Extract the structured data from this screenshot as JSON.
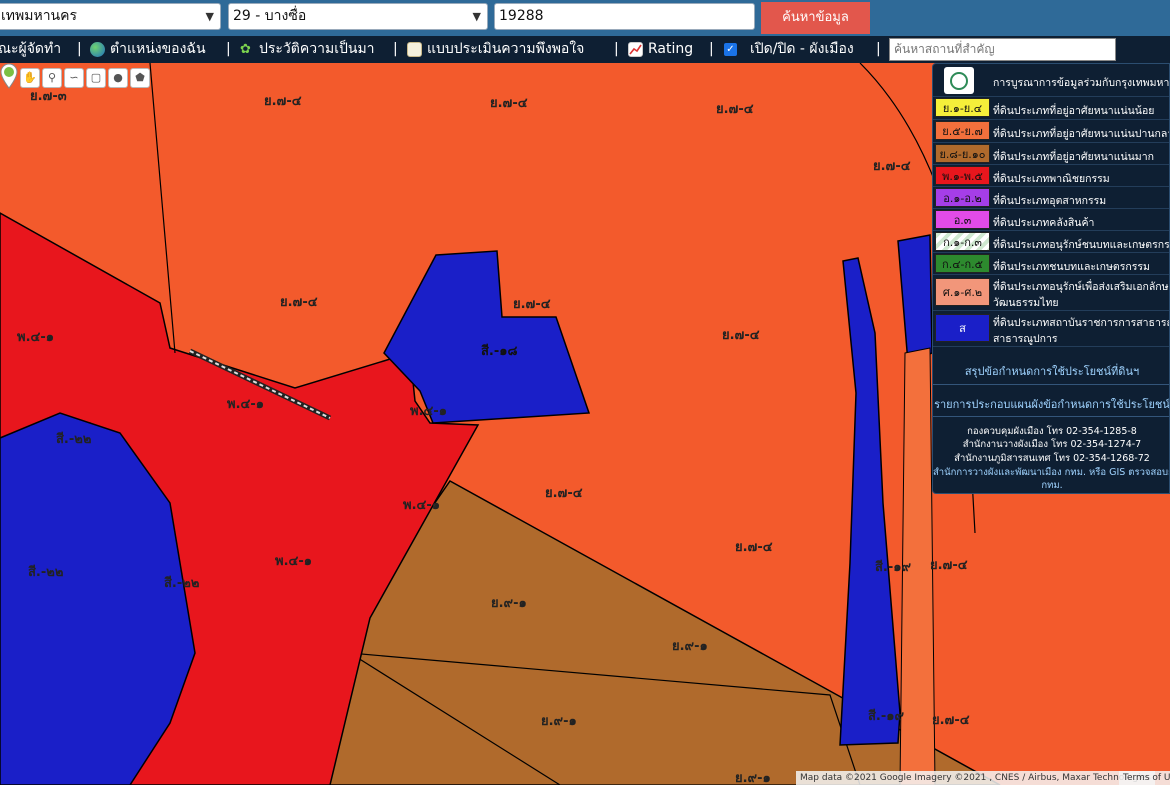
{
  "search": {
    "province": "เทพมหานคร",
    "district": "29 - บางซื่อ",
    "parcel": "19288",
    "submit_label": "ค้นหาข้อมูล"
  },
  "menu": {
    "items": [
      {
        "label": "ณะผู้จัดทำ",
        "icon": "none"
      },
      {
        "label": "ตำแหน่งของฉัน",
        "icon": "globe-icon"
      },
      {
        "label": "ประวัติความเป็นมา",
        "icon": "sprout-icon"
      },
      {
        "label": "แบบประเมินความพึงพอใจ",
        "icon": "memo-icon"
      },
      {
        "label": "Rating",
        "icon": "chart-icon"
      },
      {
        "label": "เปิด/ปิด - ผังเมือง",
        "icon": "checkbox-icon"
      }
    ],
    "place_placeholder": "ค้นหาสถานที่สำคัญ"
  },
  "map": {
    "tools": [
      "hand-icon",
      "marker-icon",
      "polyline-icon",
      "rectangle-icon",
      "circle-icon",
      "polygon-icon"
    ],
    "zone_labels": [
      "ย.๗-๓",
      "ย.๗-๔",
      "ย.๗-๔",
      "ย.๗-๔",
      "ย.๗-๔",
      "ย.๗-๔",
      "ย.๗-๔",
      "ย.๗-๔",
      "พ.๔-๑",
      "สี.-๑๘",
      "พ.๔-๑",
      "พ.๔-๑",
      "สี.-๒๒",
      "ย.๗-๔",
      "พ.๔-๑",
      "ย.๗-๔",
      "พ.๔-๑",
      "สี.-๒๒",
      "สี.-๒๒",
      "ย.๙-๑",
      "ย.๙-๑",
      "สี.-๑๙",
      "ย.๗-๔",
      "ย.๙-๑",
      "สี.-๑๙",
      "ย.๗-๔",
      "ย.๙-๑"
    ],
    "attribution": "Map data ©2021 Google Imagery ©2021 , CNES / Airbus, Maxar Technologies",
    "terms": "Terms of Us"
  },
  "legend": {
    "header": "การบูรณาการข้อมูลร่วมกับกรุงเทพมหานคร",
    "rows": [
      {
        "code": "ย.๑-ย.๔",
        "text": "ที่ดินประเภทที่อยู่อาศัยหนาแน่นน้อย",
        "color": "#f5ef3a"
      },
      {
        "code": "ย.๕-ย.๗",
        "text": "ที่ดินประเภทที่อยู่อาศัยหนาแน่นปานกลาง",
        "color": "#f3703c"
      },
      {
        "code": "ย.๘-ย.๑๐",
        "text": "ที่ดินประเภทที่อยู่อาศัยหนาแน่นมาก",
        "color": "#b06a2c"
      },
      {
        "code": "พ.๑-พ.๕",
        "text": "ที่ดินประเภทพาณิชยกรรม",
        "color": "#e8161d"
      },
      {
        "code": "อ.๑-อ.๒",
        "text": "ที่ดินประเภทอุตสาหกรรม",
        "color": "#a53ee8"
      },
      {
        "code": "อ.๓",
        "text": "ที่ดินประเภทคลังสินค้า",
        "color": "#e24be8"
      },
      {
        "code": "ก.๑-ก.๓",
        "text": "ที่ดินประเภทอนุรักษ์ชนบทและเกษตรกรรม",
        "color": "#dff0e0"
      },
      {
        "code": "ก.๔-ก.๕",
        "text": "ที่ดินประเภทชนบทและเกษตรกรรม",
        "color": "#2d8a2e"
      },
      {
        "code": "ศ.๑-ศ.๒",
        "text": "ที่ดินประเภทอนุรักษ์เพื่อส่งเสริมเอกลักษณ์",
        "text2": "วัฒนธรรมไทย",
        "color": "#f2967a"
      },
      {
        "code": "ส",
        "text": "ที่ดินประเภทสถาบันราชการการสาธารณูป",
        "text2": "สาธารณูปการ",
        "color": "#1a1fc8"
      }
    ],
    "link1": "สรุปข้อกำหนดการใช้ประโยชน์ที่ดินฯ",
    "link2": "รายการประกอบแผนผังข้อกำหนดการใช้ประโยชน์",
    "contacts": [
      "กองควบคุมผังเมือง โทร 02-354-1285-8",
      "สำนักงานวางผังเมือง โทร 02-354-1274-7",
      "สำนักงานภูมิสารสนเทศ โทร 02-354-1268-72"
    ],
    "footer": "สำนักการวางผังและพัฒนาเมือง กทม. หรือ GIS ตรวจสอบการใช้",
    "footer2": "กทม."
  }
}
